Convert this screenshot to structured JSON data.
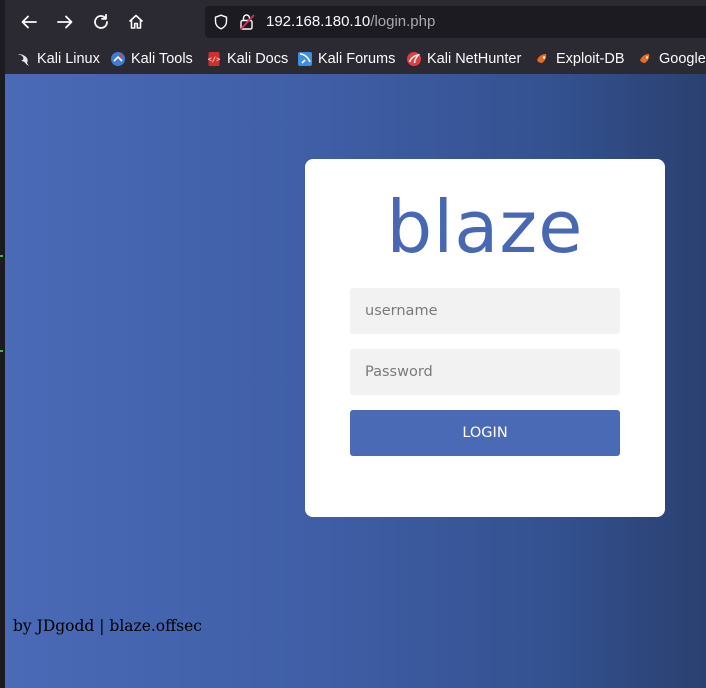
{
  "browser": {
    "url_host": "192.168.180.10",
    "url_path": "/login.php",
    "nav": {
      "back_icon": "arrow-left-icon",
      "forward_icon": "arrow-right-icon",
      "reload_icon": "reload-icon",
      "home_icon": "home-icon"
    },
    "bookmarks": [
      {
        "label": "Kali Linux",
        "icon": "kali-dragon-icon"
      },
      {
        "label": "Kali Tools",
        "icon": "kali-tools-icon"
      },
      {
        "label": "Kali Docs",
        "icon": "kali-docs-icon"
      },
      {
        "label": "Kali Forums",
        "icon": "kali-forums-icon"
      },
      {
        "label": "Kali NetHunter",
        "icon": "kali-nethunter-icon"
      },
      {
        "label": "Exploit-DB",
        "icon": "exploit-db-icon"
      },
      {
        "label": "Google Hacking DB",
        "icon": "ghdb-icon"
      }
    ]
  },
  "login": {
    "logo": "blaze",
    "username_placeholder": "username",
    "password_placeholder": "Password",
    "button_label": "LOGIN"
  },
  "footer": {
    "text": "by JDgodd | blaze.offsec"
  },
  "colors": {
    "accent": "#4a6ab6",
    "logo": "#4868b3",
    "gradient_left": "#4a6ab7",
    "gradient_right": "#2a4070"
  }
}
